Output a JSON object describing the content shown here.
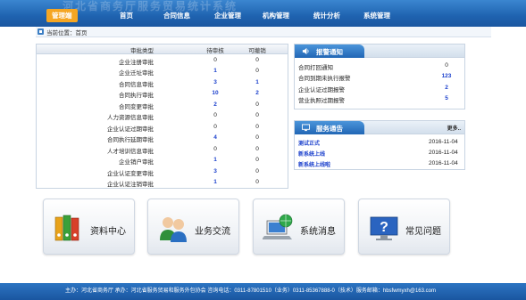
{
  "header": {
    "ghost_title": "河北省商务厅服务贸易统计系统",
    "nav": [
      {
        "label": "管理端",
        "active": true
      },
      {
        "label": "首页",
        "active": false
      },
      {
        "label": "合同信息",
        "active": false
      },
      {
        "label": "企业管理",
        "active": false
      },
      {
        "label": "机构管理",
        "active": false
      },
      {
        "label": "统计分析",
        "active": false
      },
      {
        "label": "系统管理",
        "active": false
      }
    ]
  },
  "breadcrumb": {
    "text": "当前位置：首页"
  },
  "approval_table": {
    "columns": [
      "审批类型",
      "待审核",
      "可撤销"
    ],
    "rows": [
      {
        "name": "企业注册审批",
        "pending": "0",
        "revocable": "0"
      },
      {
        "name": "企业迁址审批",
        "pending": "1",
        "revocable": "0"
      },
      {
        "name": "合同信息审批",
        "pending": "3",
        "revocable": "1"
      },
      {
        "name": "合同执行审批",
        "pending": "10",
        "revocable": "2"
      },
      {
        "name": "合同变更审批",
        "pending": "2",
        "revocable": "0"
      },
      {
        "name": "人力资源信息审批",
        "pending": "0",
        "revocable": "0"
      },
      {
        "name": "企业认证过期审批",
        "pending": "0",
        "revocable": "0"
      },
      {
        "name": "合同执行延期审批",
        "pending": "4",
        "revocable": "0"
      },
      {
        "name": "人才培训信息审批",
        "pending": "0",
        "revocable": "0"
      },
      {
        "name": "企业销户审批",
        "pending": "1",
        "revocable": "0"
      },
      {
        "name": "企业认证变更审批",
        "pending": "3",
        "revocable": "0"
      },
      {
        "name": "企业认证注销审批",
        "pending": "1",
        "revocable": "0"
      }
    ]
  },
  "alert_panel": {
    "title": "报警通知",
    "rows": [
      {
        "label": "合同打回通知",
        "value": "0"
      },
      {
        "label": "合同到期未执行报警",
        "value": "123"
      },
      {
        "label": "企业认证过期报警",
        "value": "2"
      },
      {
        "label": "营业执照过期报警",
        "value": "5"
      }
    ]
  },
  "news_panel": {
    "title": "服务通告",
    "more": "更多..",
    "rows": [
      {
        "label": "测试正式",
        "date": "2016-11-04"
      },
      {
        "label": "新系统上线",
        "date": "2016-11-04"
      },
      {
        "label": "新系统上线啦",
        "date": "2016-11-04"
      }
    ]
  },
  "tiles": [
    {
      "label": "资料中心",
      "icon": "binders-icon"
    },
    {
      "label": "业务交流",
      "icon": "users-icon"
    },
    {
      "label": "系统消息",
      "icon": "laptop-globe-icon"
    },
    {
      "label": "常见问题",
      "icon": "help-screen-icon"
    }
  ],
  "footer": {
    "text": "主办：河北省商务厅 承办：河北省服务贸易和服务外包协会 咨询电话：0311-87801510（业务）0311-85367888-0（技术）服务邮箱：hbsfwmyxh@163.com"
  },
  "colors": {
    "nav_blue": "#1f63b0",
    "active_orange": "#f5a623",
    "link_blue": "#1a3fcc"
  }
}
